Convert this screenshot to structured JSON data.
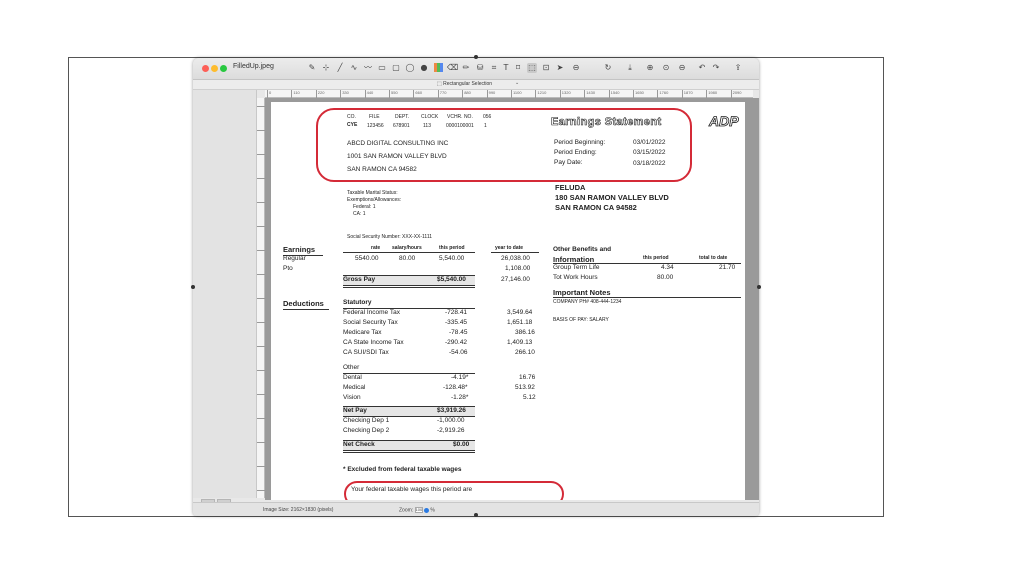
{
  "app": {
    "file_name": "FilledUp.jpeg",
    "selection_mode": "Rectangular Selection",
    "image_size": "Image Size: 2162×1830 (pixels)",
    "zoom_label": "Zoom:",
    "zoom_value": "100",
    "zoom_unit": "%",
    "ruler_numbers": [
      "0",
      "110",
      "220",
      "330",
      "440",
      "550",
      "660",
      "770",
      "880",
      "990",
      "1100",
      "1210",
      "1320",
      "1430",
      "1540",
      "1650",
      "1760",
      "1870",
      "1980",
      "2090"
    ]
  },
  "toolbar": {
    "icons": [
      "pen-tool-icon",
      "lasso-icon",
      "line-icon",
      "curve-icon",
      "freehand-icon",
      "rectangle-icon",
      "rounded-rect-icon",
      "ellipse-icon",
      "filled-circle-icon",
      "color-swatch-icon",
      "eraser-icon",
      "brush-icon",
      "fill-icon",
      "crop-icon",
      "text-icon",
      "transform-icon",
      "selection-icon",
      "magic-select-icon",
      "pointer-icon",
      "more-icon",
      "reload-icon",
      "export-icon",
      "zoom-in-icon",
      "zoom-actual-icon",
      "zoom-out-icon",
      "undo-icon",
      "redo-icon",
      "share-icon"
    ]
  },
  "doc": {
    "hdr_co": "CO.",
    "hdr_file": "FILE",
    "hdr_dept": "DEPT.",
    "hdr_clock": "CLOCK",
    "hdr_vchr": "VCHR. NO.",
    "hdr_num": "056",
    "co_val": "CYE",
    "file_val": "123456",
    "dept_val": "678901",
    "clock_val": "113",
    "vchr_val": "0000100001",
    "extra_val": "1",
    "company": "ABCD  DIGITAL  CONSULTING  INC",
    "address1": "1001  SAN RAMON  VALLEY  BLVD",
    "address2": "SAN RAMON     CA  94582",
    "statement_title": "Earnings Statement",
    "logo_text": "ADP",
    "period_begin_label": "Period Beginning:",
    "period_begin": "03/01/2022",
    "period_end_label": "Period Ending:",
    "period_end": "03/15/2022",
    "pay_date_label": "Pay Date:",
    "pay_date": "03/18/2022",
    "emp_name": "FELUDA",
    "emp_addr1": "180 SAN RAMON VALLEY BLVD",
    "emp_addr2": "SAN RAMON    CA  94582",
    "marital": "Taxable  Marital  Status:",
    "exemptions": "Exemptions/Allowances:",
    "federal": "Federal:    1",
    "ca": "CA:         1",
    "ssn": "Social  Security  Number:  XXX-XX-1111",
    "earnings_label": "Earnings",
    "col_rate": "rate",
    "col_salary": "salary/hours",
    "col_this": "this  period",
    "col_ytd": "year  to  date",
    "regular": "Regular",
    "regular_rate": "5540.00",
    "regular_hours": "80.00",
    "regular_this": "5,540.00",
    "regular_ytd": "26,038.00",
    "pto": "Pto",
    "pto_ytd": "1,108.00",
    "gross_label": "Gross  Pay",
    "gross_this": "$5,540.00",
    "gross_ytd": "27,146.00",
    "deductions_label": "Deductions",
    "statutory_label": "Statutory",
    "deductions": [
      {
        "name": "Federal  Income  Tax",
        "this": "-728.41",
        "ytd": "3,549.64"
      },
      {
        "name": "Social  Security  Tax",
        "this": "-335.45",
        "ytd": "1,651.18"
      },
      {
        "name": "Medicare  Tax",
        "this": "-78.45",
        "ytd": "386.16"
      },
      {
        "name": "CA  State  Income  Tax",
        "this": "-290.42",
        "ytd": "1,409.13"
      },
      {
        "name": "CA  SUI/SDI  Tax",
        "this": "-54.06",
        "ytd": "266.10"
      }
    ],
    "other_label": "Other",
    "other": [
      {
        "name": "Dental",
        "this": "-4.19*",
        "ytd": "16.76"
      },
      {
        "name": "Medical",
        "this": "-128.48*",
        "ytd": "513.92"
      },
      {
        "name": "Vision",
        "this": "-1.28*",
        "ytd": "5.12"
      }
    ],
    "net_pay_label": "Net  Pay",
    "net_pay": "$3,919.26",
    "checking1_label": "Checking  Dep  1",
    "checking1": "-1,000.00",
    "checking2_label": "Checking  Dep  2",
    "checking2": "-2,919.26",
    "net_check_label": "Net  Check",
    "net_check": "$0.00",
    "excluded_note": "*  Excluded  from  federal  taxable  wages",
    "taxable_wages": "Your  federal  taxable  wages  this  period  are",
    "other_benefits_label": "Other  Benefits  and",
    "information_label": "Information",
    "ob_this": "this  period",
    "ob_total": "total  to  date",
    "group_term": "Group  Term  Life",
    "group_term_this": "4.34",
    "group_term_total": "21.70",
    "tot_work": "Tot  Work  Hours",
    "tot_work_this": "80.00",
    "important_label": "Important  Notes",
    "company_ph": "COMPANY   PH#  408-444-1234",
    "basis": "BASIS  OF  PAY:  SALARY"
  }
}
